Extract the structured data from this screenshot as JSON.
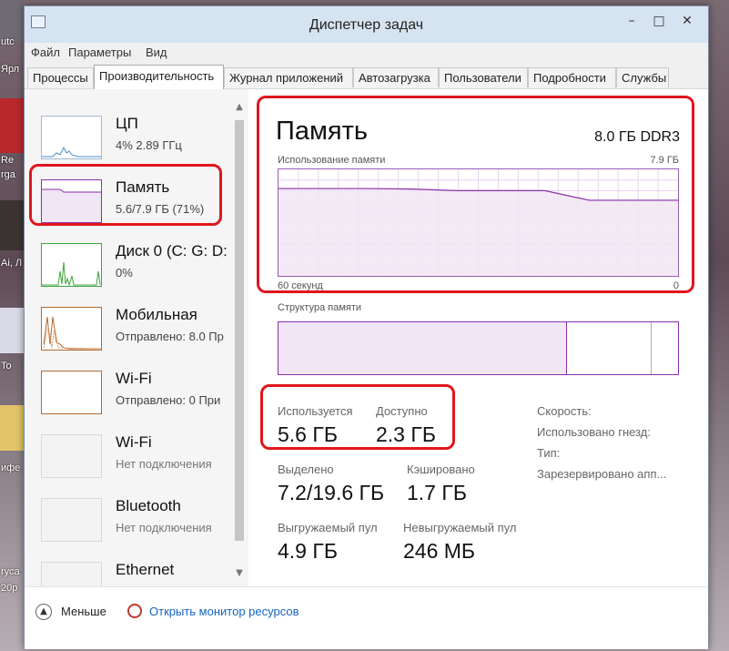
{
  "window": {
    "title": "Диспетчер задач",
    "minimize_glyph": "–",
    "maximize_glyph": "□",
    "close_glyph": "✕"
  },
  "menu": [
    "Файл",
    "Параметры",
    "Вид"
  ],
  "tabs": [
    "Процессы",
    "Производительность",
    "Журнал приложений",
    "Автозагрузка",
    "Пользователи",
    "Подробности",
    "Службы"
  ],
  "active_tab": "Производительность",
  "sidebar": {
    "items": [
      {
        "name": "ЦП",
        "sub": "4%  2.89 ГГц"
      },
      {
        "name": "Память",
        "sub": "5.6/7.9 ГБ (71%)"
      },
      {
        "name": "Диск 0 (C: G: D:",
        "sub": "0%"
      },
      {
        "name": "Мобильная",
        "sub": "Отправлено: 8.0  Пр"
      },
      {
        "name": "Wi-Fi",
        "sub": "Отправлено: 0  При"
      },
      {
        "name": "Wi-Fi",
        "sub": "Нет подключения"
      },
      {
        "name": "Bluetooth",
        "sub": "Нет подключения"
      },
      {
        "name": "Ethernet",
        "sub": ""
      }
    ]
  },
  "memory": {
    "title": "Память",
    "type": "8.0 ГБ DDR3",
    "usage_label": "Использование памяти",
    "usage_max": "7.9 ГБ",
    "time_label": "60 секунд",
    "time_zero": "0",
    "usage_history_fraction": [
      0.82,
      0.82,
      0.82,
      0.815,
      0.8,
      0.8,
      0.8,
      0.71,
      0.71,
      0.71
    ],
    "structure_label": "Структура памяти",
    "structure_in_use_fraction": 0.72,
    "stats": {
      "in_use_label": "Используется",
      "in_use_value": "5.6 ГБ",
      "available_label": "Доступно",
      "available_value": "2.3 ГБ",
      "committed_label": "Выделено",
      "committed_value": "7.2/19.6 ГБ",
      "cached_label": "Кэшировано",
      "cached_value": "1.7 ГБ",
      "paged_label": "Выгружаемый пул",
      "paged_value": "4.9 ГБ",
      "nonpaged_label": "Невыгружаемый пул",
      "nonpaged_value": "246 МБ"
    },
    "details": {
      "speed_label": "Скорость:",
      "slots_label": "Использовано гнезд:",
      "form_label": "Тип:",
      "reserved_label": "Зарезервировано апп..."
    }
  },
  "bottom": {
    "less_label": "Меньше",
    "resource_link": "Открыть монитор ресурсов"
  },
  "desktop": {
    "labels": [
      "utc",
      "Ярл",
      "Re",
      "rga",
      "Ai, Л",
      "To",
      "ифе",
      "rуса",
      "20p"
    ]
  },
  "colors": {
    "memory_accent": "#8b2fa6",
    "cpu_accent": "#4a8cc7",
    "disk_accent": "#3ea63e",
    "network_accent": "#b46a2e",
    "highlight": "#e0161d"
  }
}
